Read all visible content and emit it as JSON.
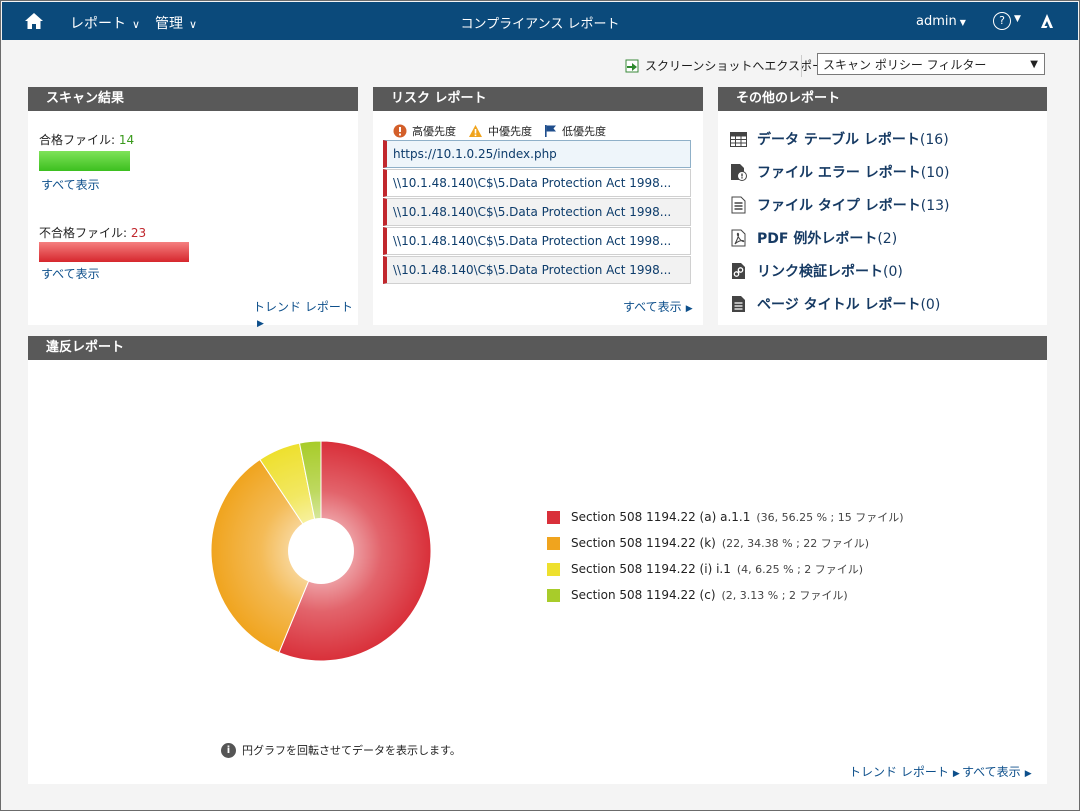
{
  "topbar": {
    "nav_reports": "レポート",
    "nav_admin": "管理",
    "title": "コンプライアンス レポート",
    "user": "admin",
    "help": "?"
  },
  "toolbar": {
    "export_label": "スクリーンショットへエクスポート",
    "filter_value": "スキャン ポリシー フィルター"
  },
  "scan_results": {
    "title": "スキャン結果",
    "pass_label": "合格ファイル: ",
    "pass_count": "14",
    "pass_view_all": "すべて表示",
    "fail_label": "不合格ファイル: ",
    "fail_count": "23",
    "fail_view_all": "すべて表示",
    "trend": "トレンド レポート"
  },
  "risk_report": {
    "title": "リスク レポート",
    "legend": {
      "high": "高優先度",
      "medium": "中優先度",
      "low": "低優先度"
    },
    "rows": [
      "https://10.1.0.25/index.php",
      "\\\\10.1.48.140\\C$\\5.Data Protection Act 1998...",
      "\\\\10.1.48.140\\C$\\5.Data Protection Act 1998...",
      "\\\\10.1.48.140\\C$\\5.Data Protection Act 1998...",
      "\\\\10.1.48.140\\C$\\5.Data Protection Act 1998..."
    ],
    "view_all": "すべて表示"
  },
  "other_reports": {
    "title": "その他のレポート",
    "items": [
      {
        "label": "データ テーブル レポート",
        "count": "(16)",
        "icon": "table-icon"
      },
      {
        "label": "ファイル エラー レポート",
        "count": "(10)",
        "icon": "file-error-icon"
      },
      {
        "label": "ファイル タイプ レポート",
        "count": "(13)",
        "icon": "file-type-icon"
      },
      {
        "label": "PDF 例外レポート",
        "count": "(2)",
        "icon": "pdf-icon"
      },
      {
        "label": "リンク検証レポート",
        "count": "(0)",
        "icon": "link-icon"
      },
      {
        "label": "ページ タイトル レポート",
        "count": "(0)",
        "icon": "page-icon"
      }
    ]
  },
  "violations": {
    "title": "違反レポート",
    "note": "円グラフを回転させてデータを表示します。",
    "trend": "トレンド レポート",
    "view_all": "すべて表示"
  },
  "chart_data": {
    "type": "pie",
    "donut": true,
    "slices": [
      {
        "label": "Section 508 1194.22 (a) a.1.1",
        "meta": "(36, 56.25 % ; 15 ファイル)",
        "value": 56.25,
        "color": "#d9303a"
      },
      {
        "label": "Section 508 1194.22 (k)",
        "meta": "(22, 34.38 % ; 22 ファイル)",
        "value": 34.38,
        "color": "#f0a41e"
      },
      {
        "label": "Section 508 1194.22 (i) i.1",
        "meta": "(4, 6.25 % ; 2 ファイル)",
        "value": 6.25,
        "color": "#eee02e"
      },
      {
        "label": "Section 508 1194.22 (c)",
        "meta": "(2, 3.13 % ; 2 ファイル)",
        "value": 3.13,
        "color": "#a8cc2a"
      }
    ]
  }
}
